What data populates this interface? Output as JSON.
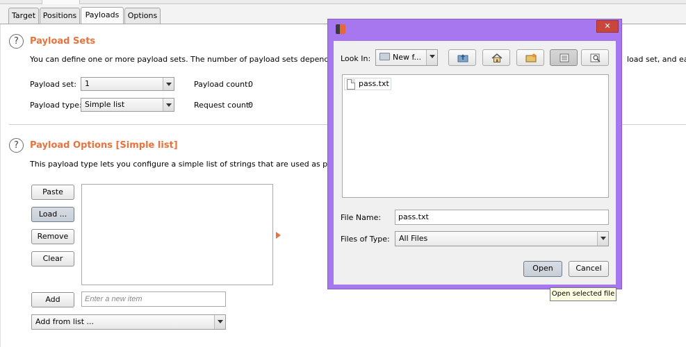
{
  "tabs": [
    {
      "label": "Target"
    },
    {
      "label": "Positions"
    },
    {
      "label": "Payloads",
      "active": true
    },
    {
      "label": "Options"
    }
  ],
  "payload_sets": {
    "title": "Payload Sets",
    "description_left": "You can define one or more payload sets. The number of payload sets depends on the a",
    "description_right": "load set, and each p",
    "set_label": "Payload set:",
    "set_value": "1",
    "type_label": "Payload type:",
    "type_value": "Simple list",
    "count_label": "Payload count:",
    "count_value": "0",
    "request_label": "Request count:",
    "request_value": "0"
  },
  "payload_options": {
    "title": "Payload Options [Simple list]",
    "description": "This payload type lets you configure a simple list of strings that are used as payloads.",
    "paste_label": "Paste",
    "load_label": "Load ...",
    "remove_label": "Remove",
    "clear_label": "Clear",
    "add_label": "Add",
    "add_placeholder": "Enter a new item",
    "add_from_list_label": "Add from list ..."
  },
  "dialog": {
    "close_glyph": "✕",
    "look_in_label": "Look In:",
    "look_in_value": "New f...",
    "files": [
      {
        "name": "pass.txt"
      }
    ],
    "file_name_label": "File Name:",
    "file_name_value": "pass.txt",
    "files_of_type_label": "Files of Type:",
    "files_of_type_value": "All Files",
    "open_label": "Open",
    "cancel_label": "Cancel",
    "tooltip": "Open selected file",
    "toolbar_icons": [
      "up-one-level-icon",
      "home-icon",
      "new-folder-icon",
      "list-view-icon",
      "details-view-icon"
    ]
  },
  "colors": {
    "section_title": "#e8733e",
    "dialog_frame": "#a777ef",
    "close_button": "#c9463d"
  }
}
